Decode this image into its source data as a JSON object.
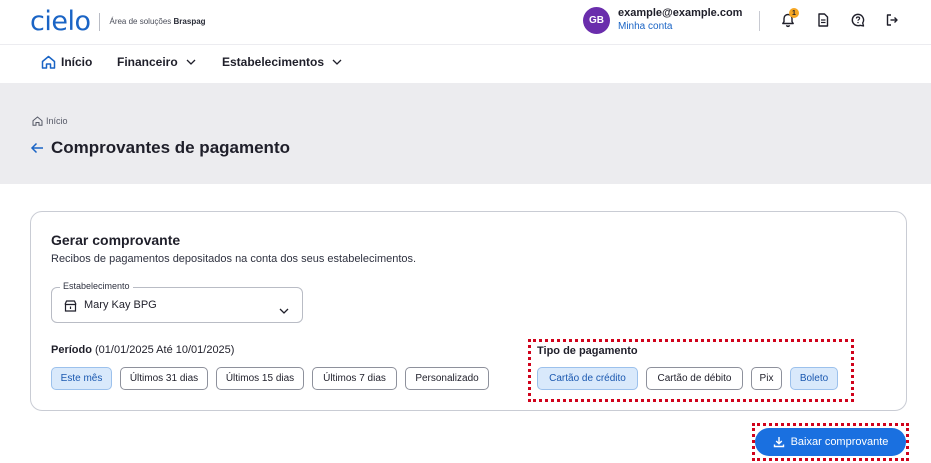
{
  "header": {
    "logo_text": "cielo",
    "subtitle_prefix": "Área de soluções ",
    "subtitle_brand": "Braspag",
    "avatar_initials": "GB",
    "user_email": "example@example.com",
    "account_link": "Minha conta",
    "notification_count": "1",
    "icons": [
      "bell-icon",
      "document-icon",
      "help-icon",
      "logout-icon"
    ]
  },
  "nav": {
    "items": [
      {
        "label": "Início",
        "icon": "home-icon"
      },
      {
        "label": "Financeiro",
        "icon": "chevron-down-icon"
      },
      {
        "label": "Estabelecimentos",
        "icon": "chevron-down-icon"
      }
    ]
  },
  "page": {
    "breadcrumb": "Início",
    "title": "Comprovantes de pagamento"
  },
  "card": {
    "title": "Gerar comprovante",
    "description": "Recibos de pagamentos depositados na conta dos seus estabelecimentos.",
    "establishment": {
      "label": "Estabelecimento",
      "value": "Mary Kay BPG"
    },
    "period": {
      "label": "Período",
      "range": " (01/01/2025 Até 10/01/2025)",
      "options": [
        "Este mês",
        "Últimos 31 dias",
        "Últimos 15 dias",
        "Últimos 7 dias",
        "Personalizado"
      ],
      "selected": "Este mês"
    },
    "payment_type": {
      "label": "Tipo de pagamento",
      "options": [
        "Cartão de crédito",
        "Cartão de débito",
        "Pix",
        "Boleto"
      ],
      "selected": [
        "Cartão de crédito",
        "Boleto"
      ]
    }
  },
  "actions": {
    "download_label": "Baixar comprovante"
  },
  "colors": {
    "brand": "#1a64c5",
    "primary_button": "#1a70e0",
    "avatar": "#6a2dac",
    "badge": "#f5a623",
    "chip_active_bg": "#d9e9fb",
    "highlight": "#d0021b"
  }
}
